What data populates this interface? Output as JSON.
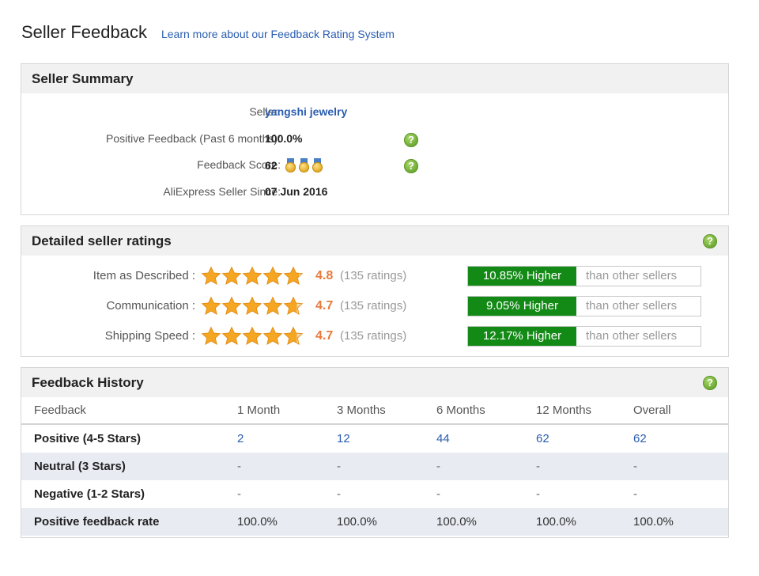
{
  "header": {
    "title": "Seller Feedback",
    "learn_link": "Learn more about our Feedback Rating System"
  },
  "summary": {
    "heading": "Seller Summary",
    "rows": [
      {
        "label": "Seller:",
        "value": "yangshi jewelry"
      },
      {
        "label": "Positive Feedback (Past 6 months):",
        "value": "100.0%"
      },
      {
        "label": "Feedback Score:",
        "value": "62"
      },
      {
        "label": "AliExpress Seller Since:",
        "value": "07 Jun 2016"
      }
    ],
    "medal_count": 3
  },
  "detailed": {
    "heading": "Detailed seller ratings",
    "rows": [
      {
        "label": "Item as Described :",
        "score": "4.8",
        "stars": 4.8,
        "count": "(135 ratings)",
        "higher": "10.85% Higher",
        "other": "than other sellers"
      },
      {
        "label": "Communication :",
        "score": "4.7",
        "stars": 4.7,
        "count": "(135 ratings)",
        "higher": "9.05% Higher",
        "other": "than other sellers"
      },
      {
        "label": "Shipping Speed :",
        "score": "4.7",
        "stars": 4.7,
        "count": "(135 ratings)",
        "higher": "12.17% Higher",
        "other": "than other sellers"
      }
    ]
  },
  "history": {
    "heading": "Feedback History",
    "columns": [
      "Feedback",
      "1 Month",
      "3 Months",
      "6 Months",
      "12 Months",
      "Overall"
    ],
    "rows": [
      {
        "label": "Positive (4-5 Stars)",
        "values": [
          "2",
          "12",
          "44",
          "62",
          "62"
        ]
      },
      {
        "label": "Neutral (3 Stars)",
        "values": [
          "-",
          "-",
          "-",
          "-",
          "-"
        ]
      },
      {
        "label": "Negative (1-2 Stars)",
        "values": [
          "-",
          "-",
          "-",
          "-",
          "-"
        ]
      },
      {
        "label": "Positive feedback rate",
        "values": [
          "100.0%",
          "100.0%",
          "100.0%",
          "100.0%",
          "100.0%"
        ]
      }
    ]
  },
  "icons": {
    "help": "question-mark-icon",
    "star": "star-icon",
    "medal": "medal-icon"
  },
  "colors": {
    "link": "#2a5db0",
    "higher_bar": "#138a16",
    "score": "#e87a3c",
    "star": "#f5a623"
  }
}
